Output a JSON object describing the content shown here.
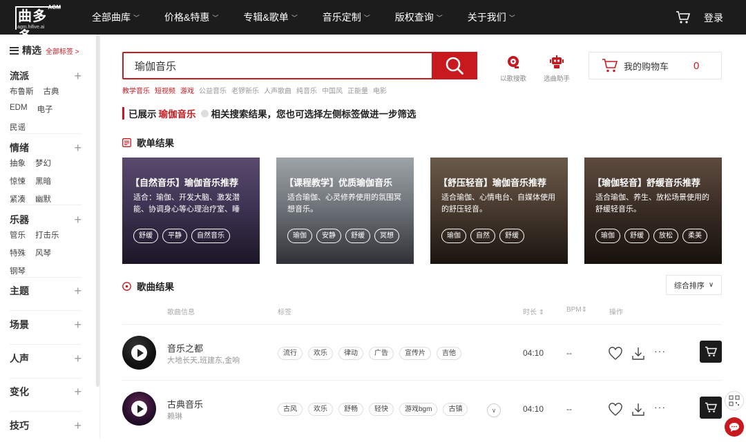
{
  "header": {
    "logo_text": "曲多多",
    "logo_badge": "AGM",
    "logo_url": "agm.hifive.ai",
    "nav": [
      {
        "label": "全部曲库"
      },
      {
        "label": "价格&特惠"
      },
      {
        "label": "专辑&歌单"
      },
      {
        "label": "音乐定制"
      },
      {
        "label": "版权查询"
      },
      {
        "label": "关于我们"
      }
    ],
    "login_label": "登录"
  },
  "sidebar": {
    "title": "精选",
    "all_tags": "全部标签 >",
    "sections": [
      {
        "title": "流派",
        "tags": [
          "布鲁斯",
          "古典",
          "EDM",
          "电子",
          "民谣"
        ]
      },
      {
        "title": "情绪",
        "tags": [
          "抽象",
          "梦幻",
          "惊悚",
          "黑暗",
          "紧凑",
          "幽默"
        ]
      },
      {
        "title": "乐器",
        "tags": [
          "管乐",
          "打击乐",
          "特殊",
          "风琴",
          "钢琴"
        ]
      },
      {
        "title": "主题",
        "tags": []
      },
      {
        "title": "场景",
        "tags": []
      },
      {
        "title": "人声",
        "tags": []
      },
      {
        "title": "变化",
        "tags": []
      },
      {
        "title": "技巧",
        "tags": []
      }
    ]
  },
  "search": {
    "value": "瑜伽音乐",
    "hotwords": [
      {
        "label": "教学音乐",
        "hot": true
      },
      {
        "label": "短视频",
        "hot": true
      },
      {
        "label": "游戏",
        "hot": true
      },
      {
        "label": "公益音乐",
        "hot": false
      },
      {
        "label": "老锣新乐",
        "hot": false
      },
      {
        "label": "人声歌曲",
        "hot": false
      },
      {
        "label": "纯音乐",
        "hot": false
      },
      {
        "label": "中国风",
        "hot": false
      },
      {
        "label": "正能量",
        "hot": false
      },
      {
        "label": "电影",
        "hot": false
      }
    ]
  },
  "tools": {
    "by_song": "以歌搜歌",
    "assistant": "选曲助手"
  },
  "cart": {
    "label": "我的购物车",
    "count": "0"
  },
  "notice": {
    "prefix": "已展示",
    "keyword": "瑜伽音乐",
    "suffix": "相关搜索结果，您也可选择左侧标签做进一步筛选"
  },
  "playlists": {
    "title": "歌单结果",
    "items": [
      {
        "title": "【自然音乐】瑜伽音乐推荐",
        "desc": "适合：瑜伽、开发大脑、激发潜能、协调身心等心理治疗室、睡",
        "tags": [
          "舒缓",
          "平静",
          "自然音乐"
        ]
      },
      {
        "title": "【课程教学】优质瑜伽音乐",
        "desc": "适合瑜伽、心灵修养使用的氛围冥想音乐。",
        "tags": [
          "瑜伽",
          "安静",
          "舒缓",
          "冥想"
        ]
      },
      {
        "title": "【舒压轻音】瑜伽音乐推荐",
        "desc": "适合瑜伽、心情电台、自媒体使用的舒压轻音。",
        "tags": [
          "瑜伽",
          "自然",
          "舒缓"
        ]
      },
      {
        "title": "【瑜伽轻音】舒缓音乐推荐",
        "desc": "适合瑜伽、养生、放松场景使用的舒缓轻音乐。",
        "tags": [
          "瑜伽",
          "舒缓",
          "放松",
          "柔美"
        ]
      }
    ]
  },
  "songs": {
    "title": "歌曲结果",
    "sort_label": "综合排序",
    "headers": {
      "info": "歌曲信息",
      "tags": "标签",
      "duration": "时长",
      "bpm": "BPM",
      "actions": "操作"
    },
    "items": [
      {
        "name": "音乐之都",
        "artist": "大地长天,班建东,金响",
        "tags": [
          "流行",
          "欢乐",
          "律动",
          "广告",
          "宣传片",
          "吉他"
        ],
        "duration": "04:10",
        "bpm": "--",
        "more_tags": false
      },
      {
        "name": "古典音乐",
        "artist": "赖琳",
        "tags": [
          "古风",
          "欢乐",
          "舒畅",
          "轻快",
          "游戏bgm",
          "古镇"
        ],
        "duration": "04:10",
        "bpm": "--",
        "more_tags": true
      }
    ]
  },
  "colors": {
    "accent": "#c8191f",
    "topbar": "#1c1c1c"
  }
}
